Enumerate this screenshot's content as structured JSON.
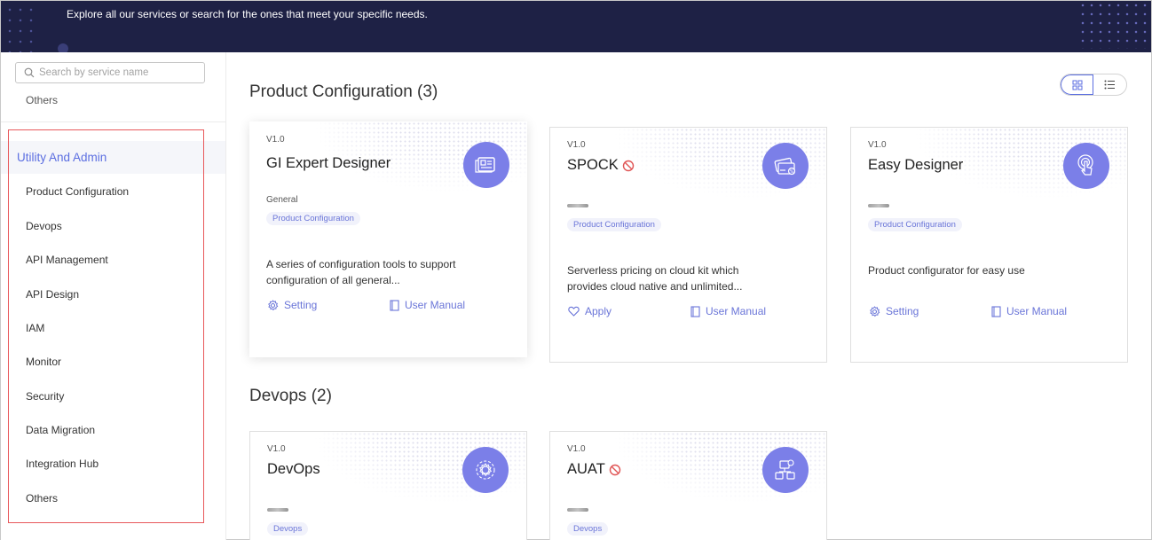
{
  "banner": {
    "tagline": "Explore all our services or search for the ones that meet your specific needs."
  },
  "sidebar": {
    "search_placeholder": "Search by service name",
    "top_item": "Others",
    "category": "Utility And Admin",
    "items": [
      "Product Configuration",
      "Devops",
      "API Management",
      "API Design",
      "IAM",
      "Monitor",
      "Security",
      "Data Migration",
      "Integration Hub",
      "Others"
    ]
  },
  "sections": [
    {
      "title": "Product Configuration (3)",
      "cards": [
        {
          "version": "V1.0",
          "name": "GI Expert Designer",
          "owner": "General",
          "tag": "Product Configuration",
          "description": "A series of configuration tools to support configuration of all general...",
          "action_left": "Setting",
          "action_right": "User Manual",
          "icon": "document-grid-icon"
        },
        {
          "version": "V1.0",
          "name": "SPOCK",
          "tag": "Product Configuration",
          "description": "Serverless pricing on cloud kit which provides cloud native and unlimited...",
          "action_left": "Apply",
          "action_right": "User Manual",
          "icon": "pricing-card-icon"
        },
        {
          "version": "V1.0",
          "name": "Easy Designer",
          "tag": "Product Configuration",
          "description": "Product configurator for easy use",
          "action_left": "Setting",
          "action_right": "User Manual",
          "icon": "touch-icon"
        }
      ]
    },
    {
      "title": "Devops (2)",
      "cards": [
        {
          "version": "V1.0",
          "name": "DevOps",
          "tag": "Devops",
          "icon": "gear-cycle-icon"
        },
        {
          "version": "V1.0",
          "name": "AUAT",
          "tag": "Devops",
          "icon": "network-gear-icon"
        }
      ]
    }
  ],
  "colors": {
    "banner_bg": "#1e2145",
    "accent": "#5b6ee1",
    "icon_circle": "#7b7fe8",
    "highlight_border": "#e8585b",
    "blocked": "#e05555"
  }
}
